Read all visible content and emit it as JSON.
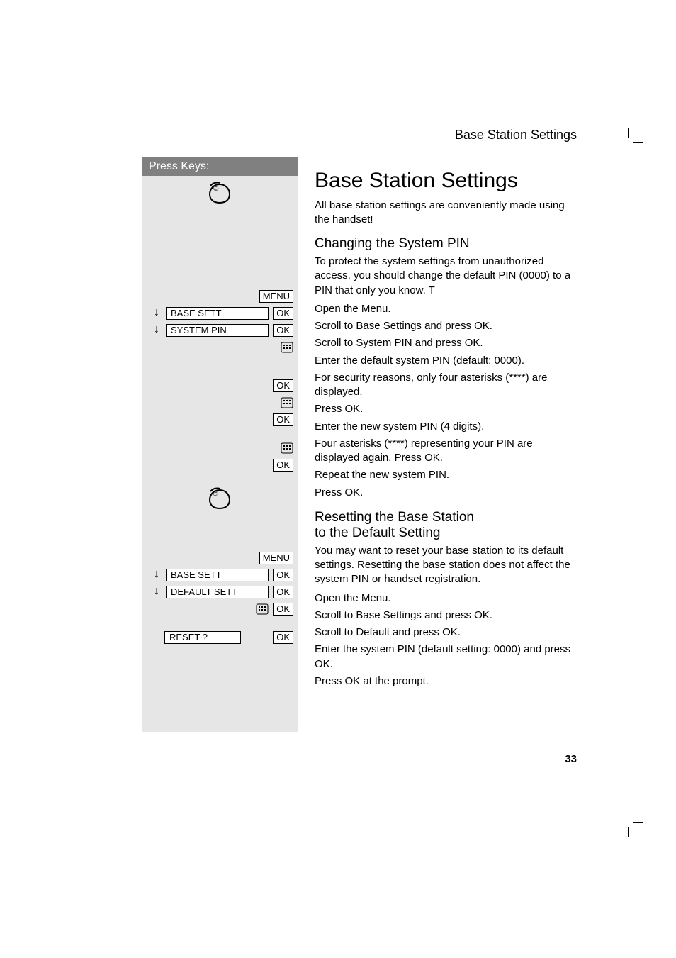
{
  "running_head": "Base Station Settings",
  "page_number": "33",
  "keycol": {
    "header": "Press Keys:",
    "sec1": {
      "menu": "MENU",
      "row_base": {
        "arrow": "↓",
        "display": "BASE SETT",
        "ok": "OK"
      },
      "row_syspin": {
        "arrow": "↓",
        "display": "SYSTEM PIN",
        "ok": "OK"
      },
      "ok1": "OK",
      "ok2": "OK",
      "ok3": "OK"
    },
    "sec2": {
      "menu": "MENU",
      "row_base": {
        "arrow": "↓",
        "display": "BASE SETT",
        "ok": "OK"
      },
      "row_default": {
        "arrow": "↓",
        "display": "DEFAULT SETT",
        "ok": "OK"
      },
      "keypad_ok": "OK",
      "row_reset": {
        "display": "RESET ?",
        "ok": "OK"
      }
    }
  },
  "text": {
    "h1": "Base Station Settings",
    "intro": "All base station settings are conveniently made using the handset!",
    "h2a": "Changing the System PIN",
    "p1": "To protect the system settings from unauthorized access, you should change the default PIN (0000) to a PIN that only you know. T",
    "s_open": "Open the Menu.",
    "s_base": "Scroll to Base Settings and press OK.",
    "s_syspin": "Scroll to System PIN and press OK.",
    "s_enter_default": "Enter the default system PIN (default: 0000).",
    "s_asterisks": "For security reasons, only four asterisks (****) are displayed.",
    "s_pressok": "Press OK.",
    "s_enter_new": "Enter the new system PIN (4 digits).",
    "s_four_again": "Four asterisks (****) representing your PIN are displayed again. Press OK.",
    "s_repeat": "Repeat the new system PIN.",
    "s_pressok2": "Press OK.",
    "h2b_l1": "Resetting the Base Station",
    "h2b_l2": "to the Default Setting",
    "p2": "You may want to reset your base station to its default settings. Resetting the base station does not affect the system PIN or handset registration.",
    "s2_open": "Open the Menu.",
    "s2_base": "Scroll to Base Settings and press OK.",
    "s2_default": "Scroll to Default and press OK.",
    "s2_enter": "Enter the system PIN (default setting: 0000) and press OK.",
    "s2_prompt": "Press OK at the prompt."
  }
}
